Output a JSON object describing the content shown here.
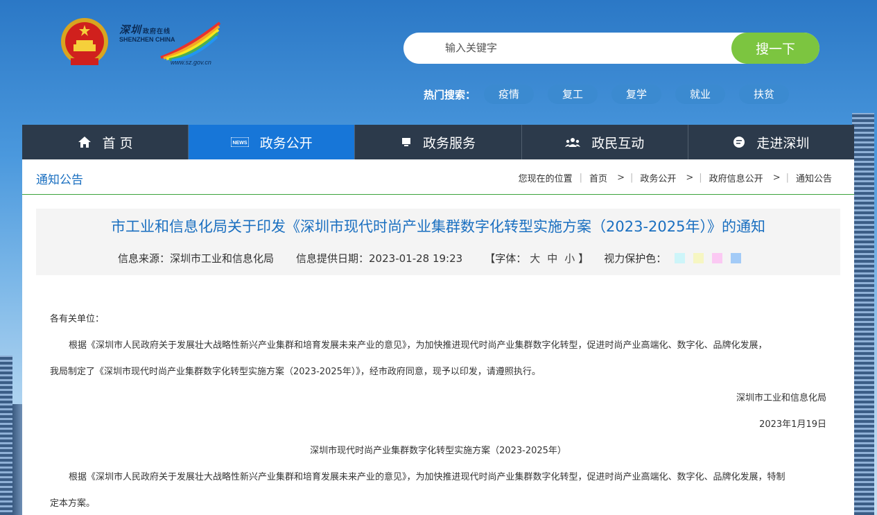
{
  "header": {
    "logo_cn": "深圳",
    "logo_cn_small": "政府在线",
    "logo_en": "SHENZHEN CHINA",
    "logo_url": "www.sz.gov.cn",
    "search_placeholder": "输入关键字",
    "search_button": "搜一下",
    "hot_label": "热门搜索：",
    "hot_tags": [
      "疫情",
      "复工",
      "复学",
      "就业",
      "扶贫"
    ]
  },
  "nav": {
    "items": [
      {
        "label": "首 页",
        "icon": "home-icon"
      },
      {
        "label": "政务公开",
        "icon": "news-icon",
        "icon_text": "NEWS",
        "active": true
      },
      {
        "label": "政务服务",
        "icon": "monitor-icon"
      },
      {
        "label": "政民互动",
        "icon": "users-icon"
      },
      {
        "label": "走进深圳",
        "icon": "chat-bubble-icon"
      }
    ]
  },
  "crumb": {
    "section_title": "通知公告",
    "location_label": "您现在的位置",
    "items": [
      "首页",
      "政务公开",
      "政府信息公开",
      "通知公告"
    ],
    "separator": ">"
  },
  "article": {
    "title": "市工业和信息化局关于印发《深圳市现代时尚产业集群数字化转型实施方案（2023-2025年）》的通知",
    "source": "信息来源：深圳市工业和信息化局",
    "date": "信息提供日期：2023-01-28 19:23",
    "font_label": "【字体：",
    "font_sizes": [
      "大",
      "中",
      "小"
    ],
    "font_close": "】",
    "eye_label": "视力保护色：",
    "eye_colors": [
      "#cdf5f9",
      "#f6f6c2",
      "#fbc9f3",
      "#a3cbf7"
    ],
    "salutation": "各有关单位：",
    "para1_line1": "根据《深圳市人民政府关于发展壮大战略性新兴产业集群和培育发展未来产业的意见》，为加快推进现代时尚产业集群数字化转型，促进时尚产业高端化、数字化、品牌化发展，",
    "para1_line2": "我局制定了《深圳市现代时尚产业集群数字化转型实施方案（2023-2025年）》，经市政府同意，现予以印发，请遵照执行。",
    "signature": "深圳市工业和信息化局",
    "sign_date": "2023年1月19日",
    "subtitle": "深圳市现代时尚产业集群数字化转型实施方案（2023-2025年）",
    "para2_line1": "根据《深圳市人民政府关于发展壮大战略性新兴产业集群和培育发展未来产业的意见》，为加快推进现代时尚产业集群数字化转型，促进时尚产业高端化、数字化、品牌化发展，特制",
    "para2_line2": "定本方案。"
  },
  "colors": {
    "nav_bg": "#2c3a4b",
    "nav_active": "#1776d8",
    "link_blue": "#1a6fc0",
    "search_green": "#7cc540",
    "hot_tag_bg": "#3b8ad0",
    "crumb_underline": "#3aa23a"
  }
}
